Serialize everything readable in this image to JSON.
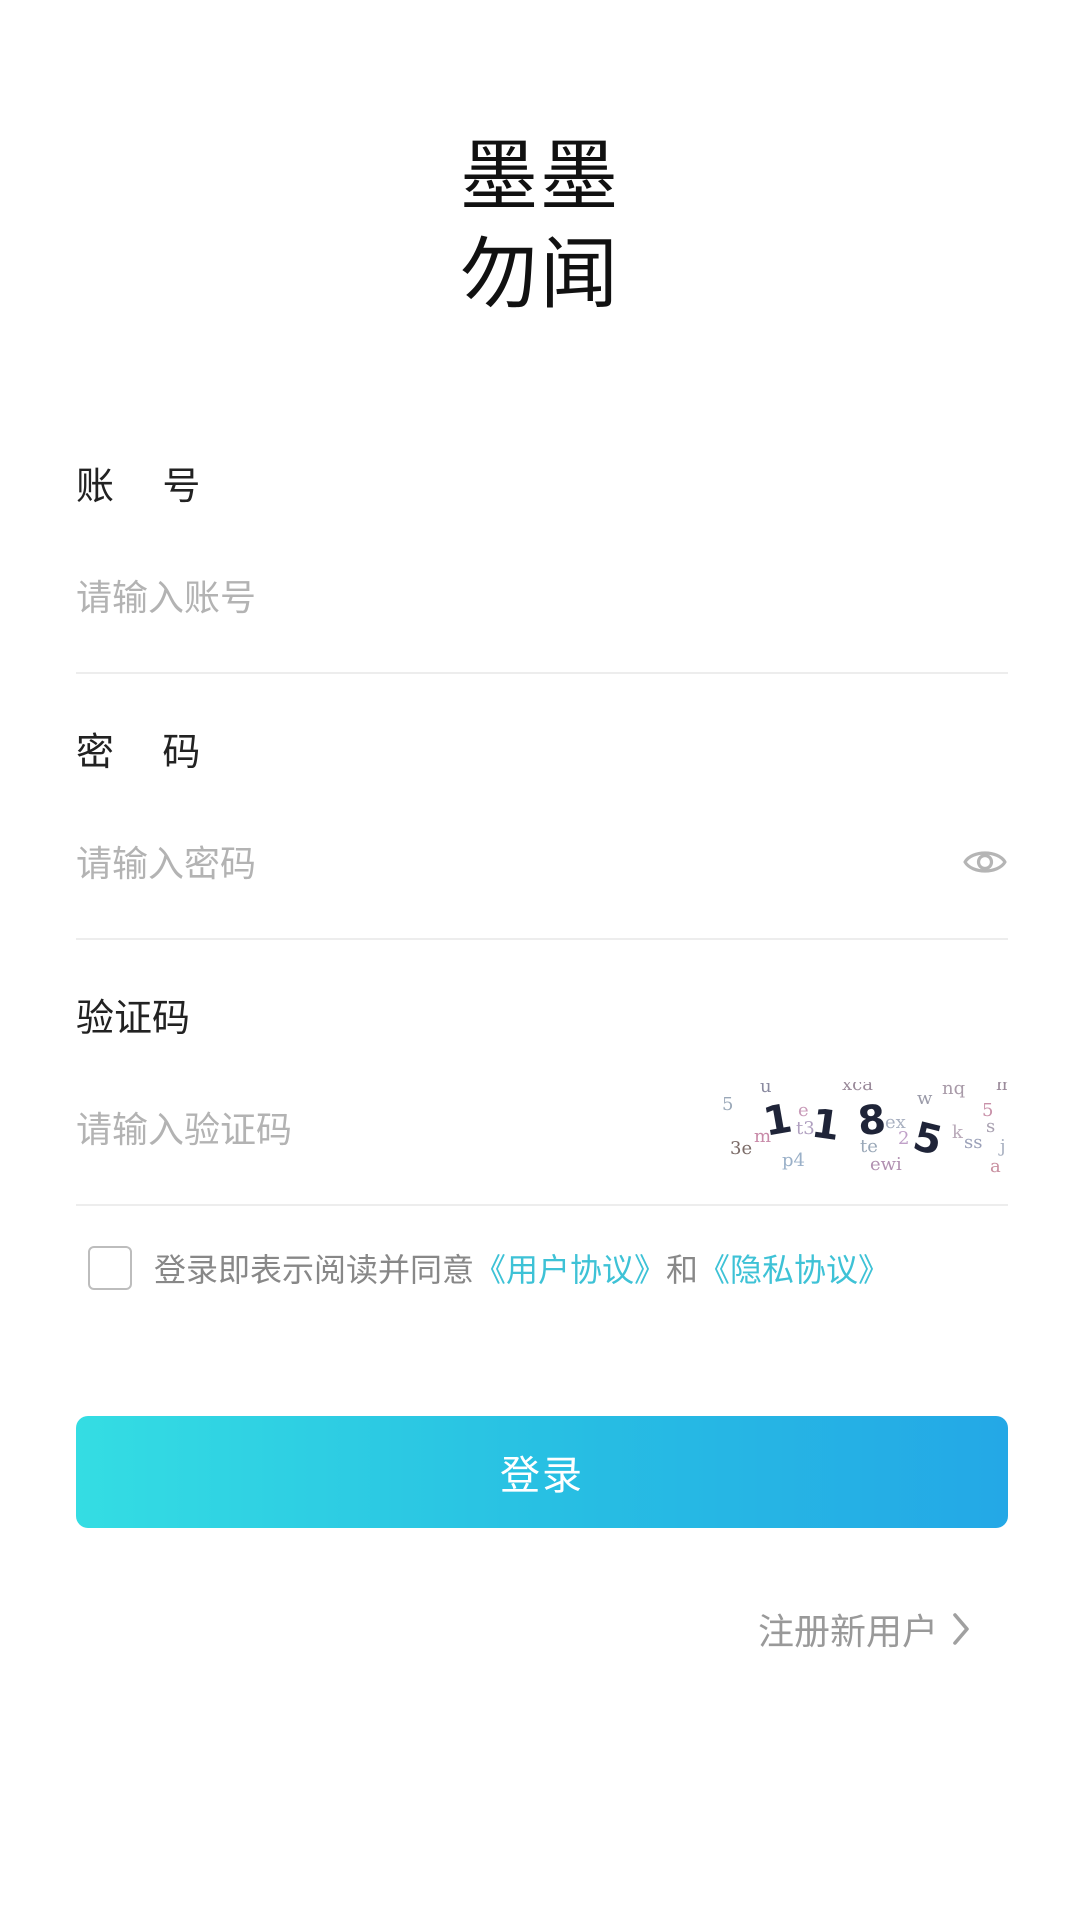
{
  "logo": {
    "line1": "墨墨",
    "line2": "勿闻"
  },
  "account": {
    "label": "账    号",
    "placeholder": "请输入账号",
    "value": ""
  },
  "password": {
    "label": "密    码",
    "placeholder": "请输入密码",
    "value": "",
    "toggle_icon": "eye-icon"
  },
  "captcha": {
    "label": "验证码",
    "placeholder": "请输入验证码",
    "value": "",
    "image_code": "1185"
  },
  "agreement": {
    "checked": false,
    "text": "登录即表示阅读并同意",
    "user_agreement": "《用户协议》",
    "and": "和",
    "privacy_policy": "《隐私协议》"
  },
  "login": {
    "label": "登录"
  },
  "register": {
    "label": "注册新用户",
    "icon": "chevron-right-icon"
  },
  "colors": {
    "background": "#ffffff",
    "accent": "#27bde3",
    "link": "#3ec2d6",
    "placeholder": "#b3b3b3",
    "divider": "#ededed"
  }
}
